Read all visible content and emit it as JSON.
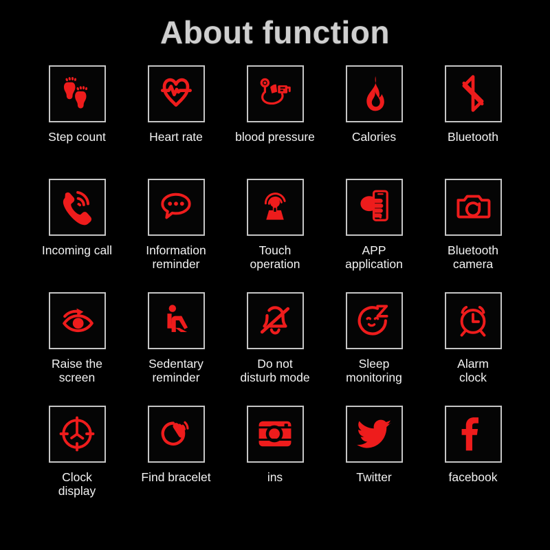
{
  "page": {
    "title": "About function",
    "background_color": "#000000",
    "title_color": "#cfcfcf",
    "icon_color": "#ee1c1c",
    "tile_border_color": "#c6c6c6",
    "label_color": "#f2f2f2"
  },
  "grid": {
    "columns": 5,
    "rows": 4,
    "items": [
      {
        "label": "Step count",
        "icon": "footprints-icon"
      },
      {
        "label": "Heart rate",
        "icon": "heart-pulse-icon"
      },
      {
        "label": "blood pressure",
        "icon": "blood-pressure-monitor-icon"
      },
      {
        "label": "Calories",
        "icon": "flame-icon"
      },
      {
        "label": "Bluetooth",
        "icon": "bluetooth-icon"
      },
      {
        "label": "Incoming call",
        "icon": "ringing-phone-icon"
      },
      {
        "label": "Information\nreminder",
        "icon": "speech-bubble-dots-icon"
      },
      {
        "label": "Touch\noperation",
        "icon": "touch-hand-ripple-icon"
      },
      {
        "label": "APP\napplication",
        "icon": "hand-holding-phone-icon"
      },
      {
        "label": "Bluetooth\ncamera",
        "icon": "camera-icon"
      },
      {
        "label": "Raise the\nscreen",
        "icon": "eye-rotate-icon"
      },
      {
        "label": "Sedentary\nreminder",
        "icon": "seated-person-icon"
      },
      {
        "label": "Do not\ndisturb mode",
        "icon": "bell-slash-icon"
      },
      {
        "label": "Sleep\nmonitoring",
        "icon": "sleeping-face-z-icon"
      },
      {
        "label": "Alarm\nclock",
        "icon": "alarm-clock-icon"
      },
      {
        "label": "Clock\ndisplay",
        "icon": "clock-dial-icon"
      },
      {
        "label": "Find bracelet",
        "icon": "bracelet-vibrate-icon"
      },
      {
        "label": "ins",
        "icon": "instagram-icon"
      },
      {
        "label": "Twitter",
        "icon": "twitter-bird-icon"
      },
      {
        "label": "facebook",
        "icon": "facebook-f-icon"
      }
    ]
  }
}
